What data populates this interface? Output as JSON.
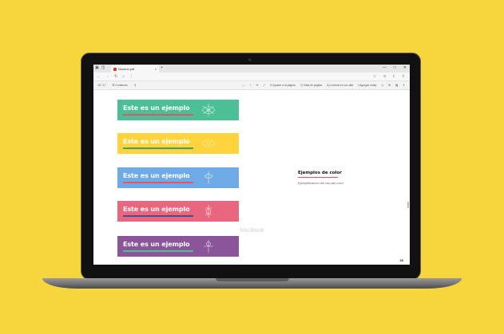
{
  "browser": {
    "tab_title": "Nosdoc.pdf",
    "tab_close": "×",
    "new_tab": "+",
    "window_controls": [
      "—",
      "□",
      "✕"
    ],
    "title_left_icons": [
      "▣",
      "◫"
    ],
    "nav_icons": [
      "←",
      "→",
      "↻",
      "⌂",
      "⋮"
    ],
    "nav_right_icons": [
      "☆",
      "≡",
      "ℓ",
      "⇪"
    ],
    "pdf_toolbar_left": [
      "16 / 17",
      "☰ Contenido",
      "⚲"
    ],
    "pdf_toolbar_right": [
      "—",
      "+",
      "⟲",
      "⤢",
      "⊡ Ajustar a la página",
      "◫ Vista de página",
      "A) Lectura en voz alta",
      "ℓ Agregar notas",
      "⎙",
      "⊞",
      "▤",
      "⇪"
    ]
  },
  "document": {
    "banners": [
      {
        "text": "Este es un ejemplo",
        "color": "#4cbf96",
        "underline": "#e2546d"
      },
      {
        "text": "Este es un ejemplo",
        "color": "#ffd33b",
        "underline": "#3f9d7d"
      },
      {
        "text": "Este es un ejemplo",
        "color": "#6eabe6",
        "underline": "#e2546d"
      },
      {
        "text": "Este es un ejemplo",
        "color": "#e8677f",
        "underline": "#4c4c8a"
      },
      {
        "text": "Este es un ejemplo",
        "color": "#8a5599",
        "underline": "#4cbf96"
      }
    ],
    "section_title": "Ejemplos de color",
    "section_description": "Ejemplificación del uso del color.",
    "page_number": "26"
  },
  "laptop": {
    "brand_label": "MacBook"
  },
  "colors": {
    "background": "#f7d53d",
    "accent_rule": "#e2546d"
  }
}
